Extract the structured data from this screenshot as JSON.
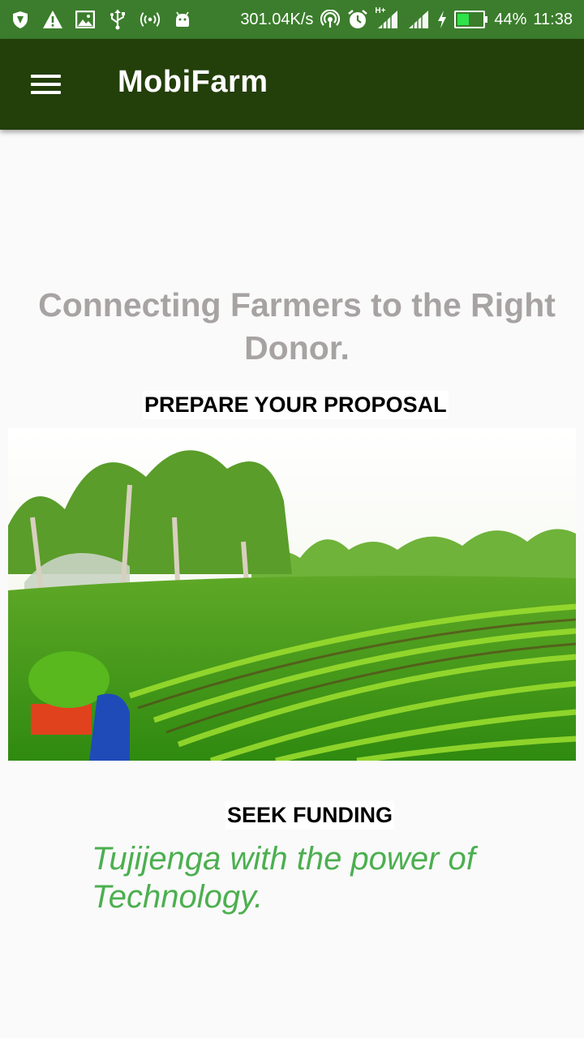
{
  "status_bar": {
    "network_speed": "301.04K/s",
    "battery_percent": "44%",
    "time": "11:38",
    "network_tag": "H+",
    "icons": [
      "vpn-shield-icon",
      "warning-icon",
      "image-icon",
      "usb-icon",
      "hotspot-icon",
      "android-icon",
      "nfc-icon",
      "alarm-icon",
      "signal-icon",
      "signal-icon",
      "charging-icon",
      "battery-icon"
    ]
  },
  "app_bar": {
    "title": "MobiFarm",
    "menu_icon": "hamburger-menu-icon"
  },
  "main": {
    "tagline": "Connecting Farmers to the Right Donor.",
    "prepare_label": "PREPARE YOUR PROPOSAL",
    "funding_label": "SEEK FUNDING",
    "slogan": "Tujijenga with the power of Technology."
  },
  "colors": {
    "status_bar": "#3b7d2c",
    "app_bar": "#233f0a",
    "tagline": "#a8a3a3",
    "slogan": "#4caf50",
    "background": "#fafafa"
  }
}
